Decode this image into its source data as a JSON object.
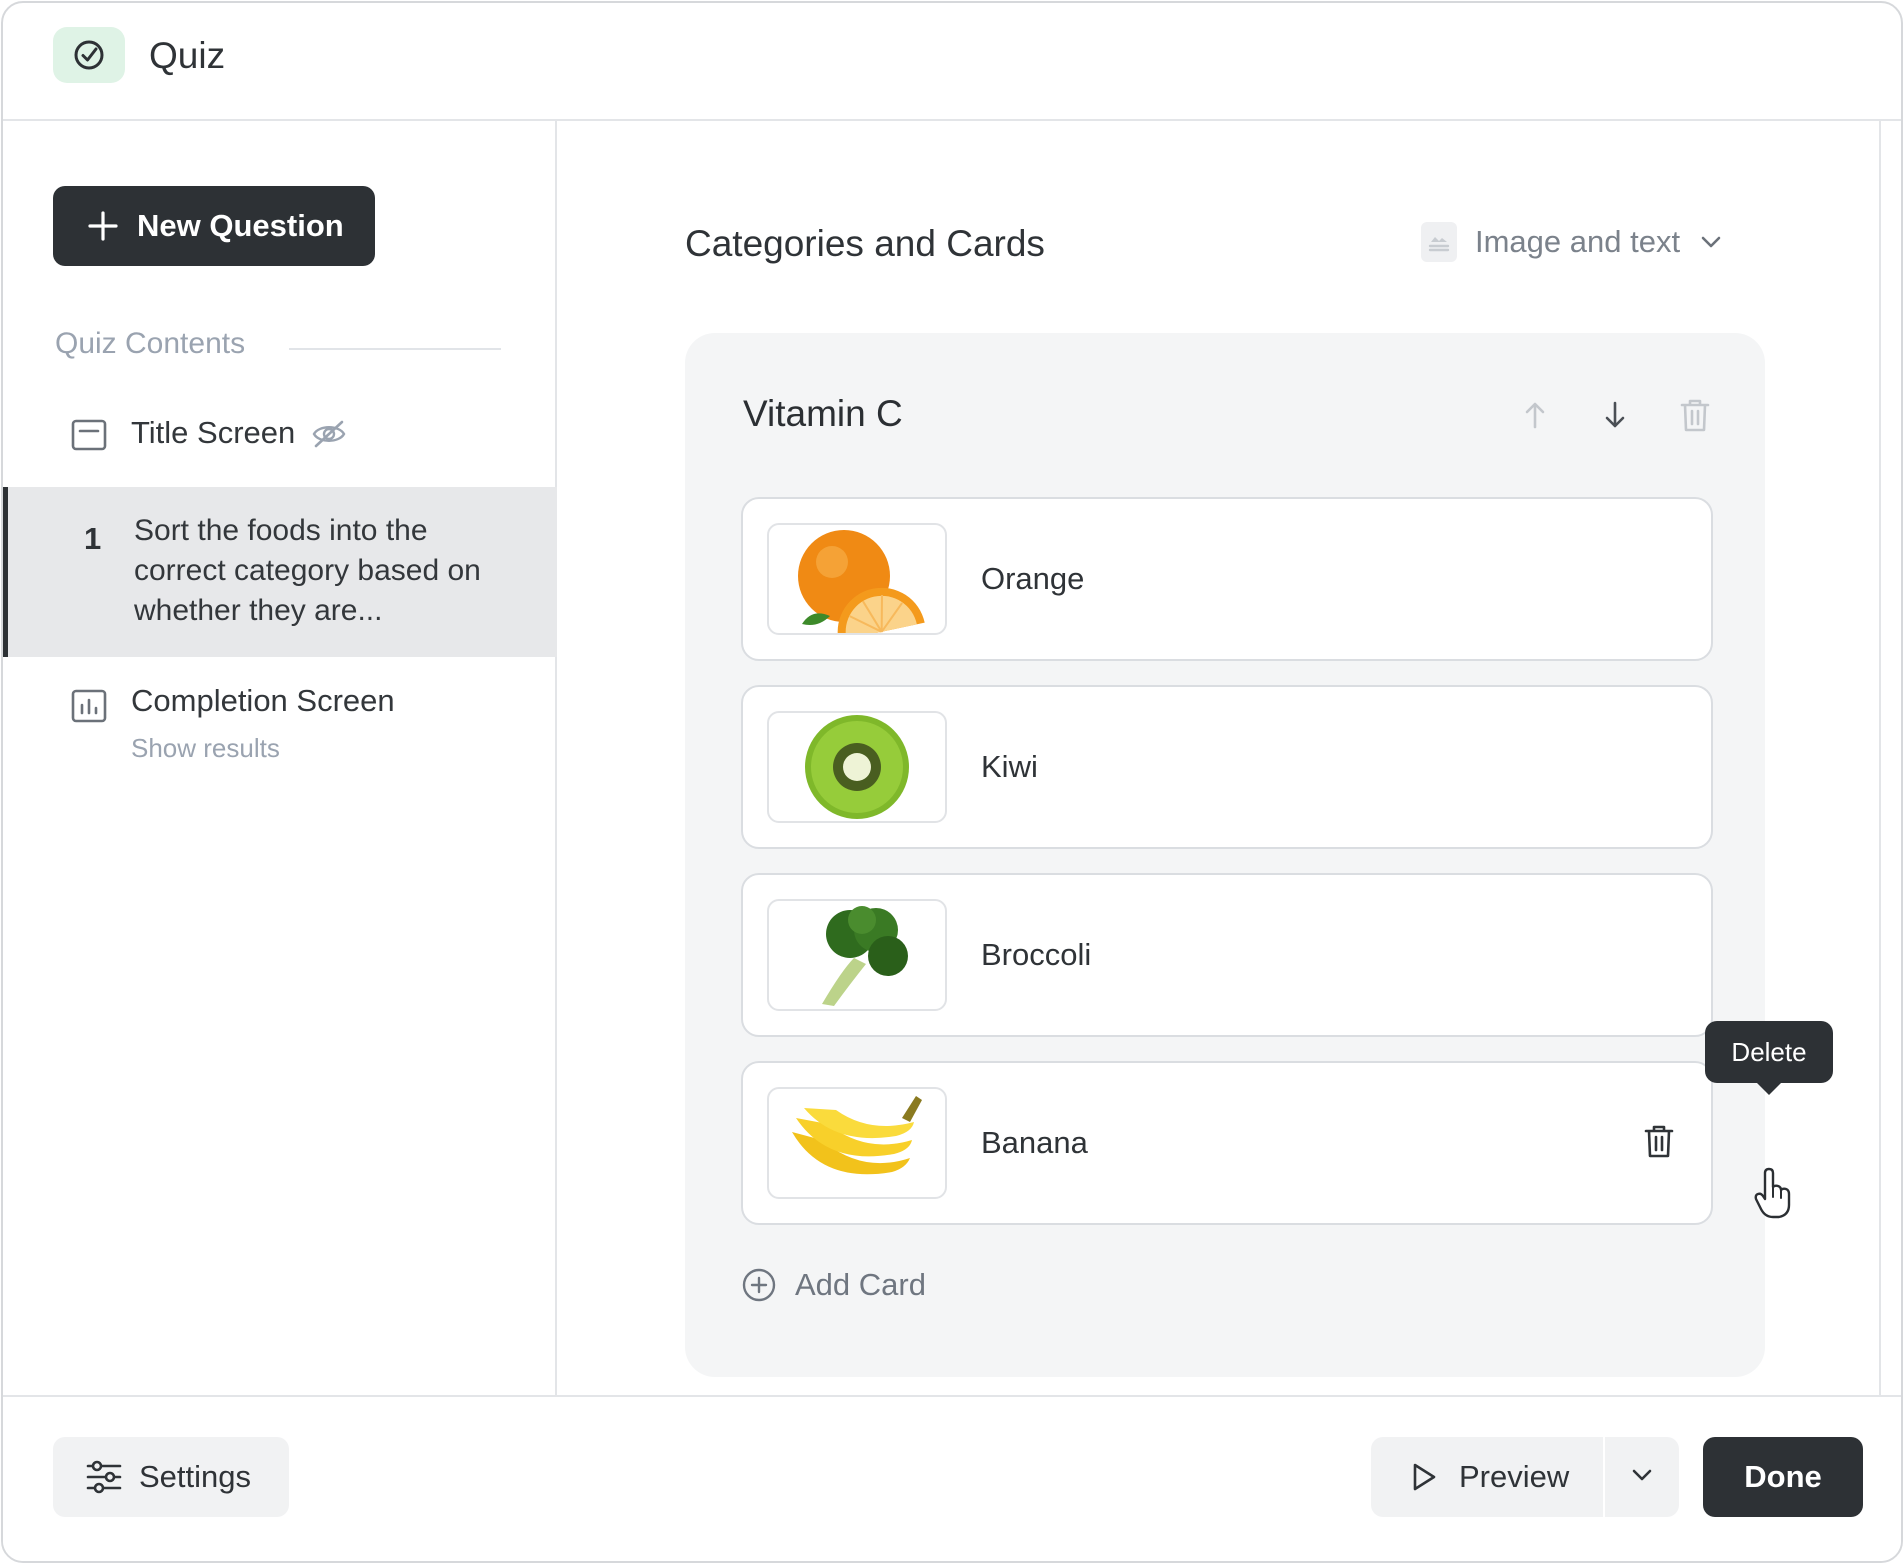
{
  "app": {
    "title": "Quiz",
    "icon": "check-circle-icon"
  },
  "sidebar": {
    "new_question_label": "New Question",
    "section_label": "Quiz Contents",
    "title_screen": {
      "label": "Title Screen",
      "icon": "layout-icon",
      "status_icon": "eye-off-icon"
    },
    "question": {
      "number": "1",
      "text": "Sort the foods into the correct category based on whether they are..."
    },
    "completion_screen": {
      "label": "Completion Screen",
      "sublabel": "Show results",
      "icon": "chart-icon"
    }
  },
  "main": {
    "title": "Categories and Cards",
    "mode_select": {
      "value": "Image and text",
      "icon": "image-icon"
    },
    "category": {
      "name": "Vitamin C",
      "cards": [
        {
          "label": "Orange",
          "image": "orange-image"
        },
        {
          "label": "Kiwi",
          "image": "kiwi-image"
        },
        {
          "label": "Broccoli",
          "image": "broccoli-image"
        },
        {
          "label": "Banana",
          "image": "banana-image"
        }
      ],
      "add_card_label": "Add Card"
    },
    "tooltip": "Delete"
  },
  "footer": {
    "settings_label": "Settings",
    "preview_label": "Preview",
    "done_label": "Done"
  },
  "colors": {
    "primary_dark": "#2d3135",
    "accent_green_bg": "#dff3e6",
    "muted_text": "#9aa3b0",
    "panel_bg": "#f4f5f6"
  }
}
